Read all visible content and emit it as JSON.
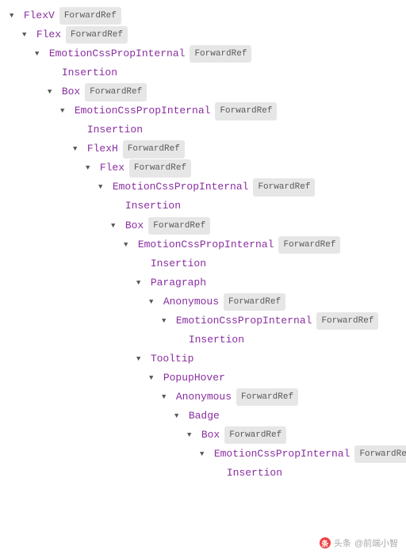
{
  "badgeText": "ForwardRef",
  "watermark": {
    "prefix": "头条",
    "handle": "@前端小智"
  },
  "tree": [
    {
      "depth": 0,
      "arrow": "down",
      "name": "FlexV",
      "badge": true
    },
    {
      "depth": 1,
      "arrow": "down",
      "name": "Flex",
      "badge": true
    },
    {
      "depth": 2,
      "arrow": "down",
      "name": "EmotionCssPropInternal",
      "badge": true
    },
    {
      "depth": 3,
      "arrow": "none",
      "name": "Insertion",
      "badge": false
    },
    {
      "depth": 3,
      "arrow": "down",
      "name": "Box",
      "badge": true
    },
    {
      "depth": 4,
      "arrow": "down",
      "name": "EmotionCssPropInternal",
      "badge": true
    },
    {
      "depth": 5,
      "arrow": "none",
      "name": "Insertion",
      "badge": false
    },
    {
      "depth": 5,
      "arrow": "down",
      "name": "FlexH",
      "badge": true
    },
    {
      "depth": 6,
      "arrow": "down",
      "name": "Flex",
      "badge": true
    },
    {
      "depth": 7,
      "arrow": "down",
      "name": "EmotionCssPropInternal",
      "badge": true
    },
    {
      "depth": 8,
      "arrow": "none",
      "name": "Insertion",
      "badge": false
    },
    {
      "depth": 8,
      "arrow": "down",
      "name": "Box",
      "badge": true
    },
    {
      "depth": 9,
      "arrow": "down",
      "name": "EmotionCssPropInternal",
      "badge": true
    },
    {
      "depth": 10,
      "arrow": "none",
      "name": "Insertion",
      "badge": false
    },
    {
      "depth": 10,
      "arrow": "down",
      "name": "Paragraph",
      "badge": false
    },
    {
      "depth": 11,
      "arrow": "down",
      "name": "Anonymous",
      "badge": true
    },
    {
      "depth": 12,
      "arrow": "down",
      "name": "EmotionCssPropInternal",
      "badge": true
    },
    {
      "depth": 13,
      "arrow": "none",
      "name": "Insertion",
      "badge": false
    },
    {
      "depth": 10,
      "arrow": "down",
      "name": "Tooltip",
      "badge": false
    },
    {
      "depth": 11,
      "arrow": "down",
      "name": "PopupHover",
      "badge": false
    },
    {
      "depth": 12,
      "arrow": "down",
      "name": "Anonymous",
      "badge": true
    },
    {
      "depth": 13,
      "arrow": "down",
      "name": "Badge",
      "badge": false
    },
    {
      "depth": 14,
      "arrow": "down",
      "name": "Box",
      "badge": true
    },
    {
      "depth": 15,
      "arrow": "down",
      "name": "EmotionCssPropInternal",
      "badge": true
    },
    {
      "depth": 16,
      "arrow": "none",
      "name": "Insertion",
      "badge": false
    }
  ]
}
